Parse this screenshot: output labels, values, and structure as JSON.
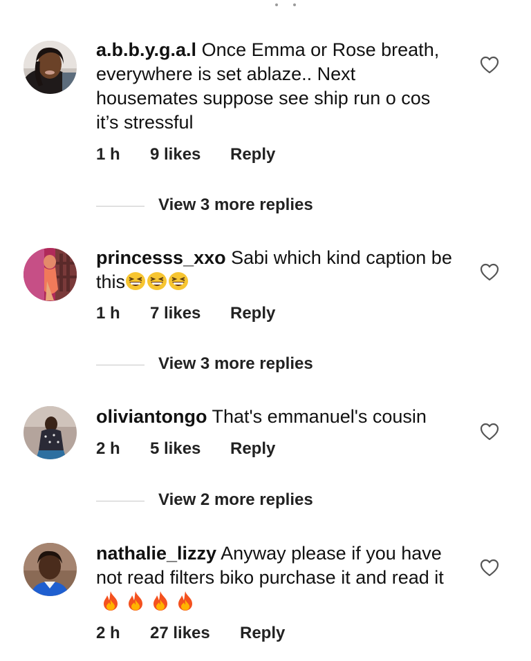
{
  "comments": [
    {
      "username": "a.b.b.y.g.a.l",
      "text": "Once Emma or Rose breath, everywhere is set ablaze.. Next housemates suppose see ship run o cos it’s stressful",
      "time": "1 h",
      "likes": "9 likes",
      "reply": "Reply",
      "view_more": "View 3 more replies"
    },
    {
      "username": "princesss_xxo",
      "text": "Sabi which kind caption be this",
      "time": "1 h",
      "likes": "7 likes",
      "reply": "Reply",
      "view_more": "View 3 more replies"
    },
    {
      "username": "oliviantongo",
      "text": "That's emmanuel's cousin",
      "time": "2 h",
      "likes": "5 likes",
      "reply": "Reply",
      "view_more": "View 2 more replies"
    },
    {
      "username": "nathalie_lizzy",
      "text": "Anyway please if you have not read filters biko purchase it and read it",
      "time": "2 h",
      "likes": "27 likes",
      "reply": "Reply"
    }
  ],
  "icons": {
    "like": "heart-outline-icon",
    "laugh": "grinning-squinting-face-icon",
    "fire": "fire-icon"
  },
  "colors": {
    "text": "#111111",
    "meta": "#222222",
    "divider": "#c7c7c7",
    "heart_stroke": "#555555"
  }
}
